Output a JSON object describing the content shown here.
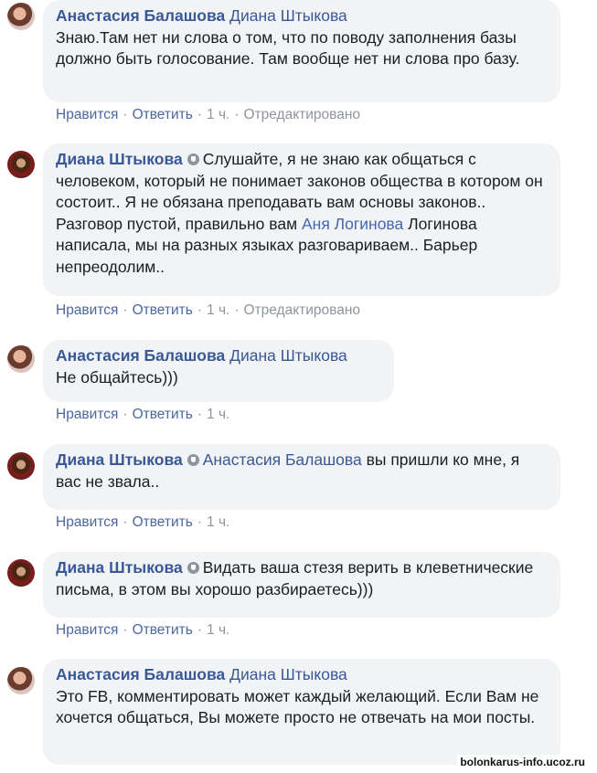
{
  "comments": [
    {
      "author": "Анастасия Балашова",
      "verified": false,
      "mention": "Диана Штыкова",
      "text": "Знаю.Там нет ни слова о том, что по поводу заполнения базы должно быть голосование. Там вообще нет ни слова про базу.",
      "like": "Нравится",
      "reply": "Ответить",
      "time": "1 ч.",
      "edited": "Отредактировано",
      "avatar_icon": "user-avatar-anastasia"
    },
    {
      "author": "Диана Штыкова",
      "verified": true,
      "text_before": "Слушайте, я не знаю как общаться с человеком, который не понимает законов общества в котором он состоит.. Я не обязана преподавать вам основы законов.. Разговор пустой, правильно вам",
      "mention": "Аня Логинова",
      "text_after": "Логинова написала, мы на разных языках разговариваем.. Барьер непреодолим..",
      "like": "Нравится",
      "reply": "Ответить",
      "time": "1 ч.",
      "edited": "Отредактировано",
      "avatar_icon": "user-avatar-diana"
    },
    {
      "author": "Анастасия Балашова",
      "verified": false,
      "mention": "Диана Штыкова",
      "text": "Не общайтесь)))",
      "like": "Нравится",
      "reply": "Ответить",
      "time": "1 ч.",
      "avatar_icon": "user-avatar-anastasia"
    },
    {
      "author": "Диана Штыкова",
      "verified": true,
      "mention": "Анастасия Балашова",
      "text": "вы пришли ко мне, я вас не звала..",
      "like": "Нравится",
      "reply": "Ответить",
      "time": "1 ч.",
      "avatar_icon": "user-avatar-diana"
    },
    {
      "author": "Диана Штыкова",
      "verified": true,
      "text": "Видать ваша стезя верить в клеветнические письма, в этом вы хорошо разбираетесь)))",
      "like": "Нравится",
      "reply": "Ответить",
      "time": "1 ч.",
      "avatar_icon": "user-avatar-diana"
    },
    {
      "author": "Анастасия Балашова",
      "verified": false,
      "mention": "Диана Штыкова",
      "text": "Это FB, комментировать может каждый желающий. Если Вам не хочется общаться, Вы можете просто не отвечать на мои посты.",
      "avatar_icon": "user-avatar-anastasia"
    }
  ],
  "watermark": "bolonkarus-info.ucoz.ru",
  "colors": {
    "author": "#385898",
    "bubble_bg": "#f2f3f5",
    "meta_gray": "#90949c",
    "action_link": "#4b67a1"
  },
  "icons": {
    "verified_badge": "shield-badge-icon"
  }
}
